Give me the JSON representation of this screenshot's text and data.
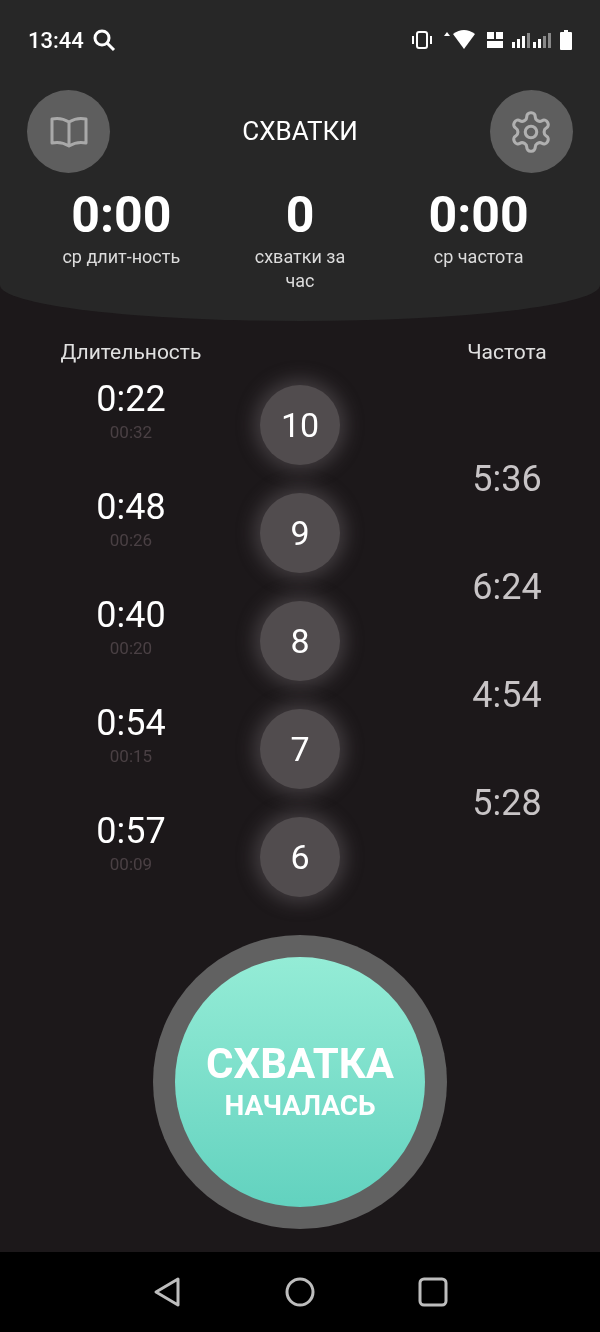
{
  "status_bar": {
    "time": "13:44"
  },
  "header": {
    "title": "СХВАТКИ"
  },
  "stats": [
    {
      "value": "0:00",
      "label": "ср длит-ность"
    },
    {
      "value": "0",
      "label": "схватки за час"
    },
    {
      "value": "0:00",
      "label": "ср частота"
    }
  ],
  "columns": {
    "duration": "Длительность",
    "frequency": "Частота"
  },
  "contractions": [
    {
      "number": "10",
      "duration": "0:22",
      "time": "00:32"
    },
    {
      "number": "9",
      "duration": "0:48",
      "time": "00:26"
    },
    {
      "number": "8",
      "duration": "0:40",
      "time": "00:20"
    },
    {
      "number": "7",
      "duration": "0:54",
      "time": "00:15"
    },
    {
      "number": "6",
      "duration": "0:57",
      "time": "00:09"
    }
  ],
  "frequencies": [
    "5:36",
    "6:24",
    "4:54",
    "5:28"
  ],
  "main_button": {
    "line_1": "СХВАТКА",
    "line_2": "НАЧАЛАСЬ"
  }
}
